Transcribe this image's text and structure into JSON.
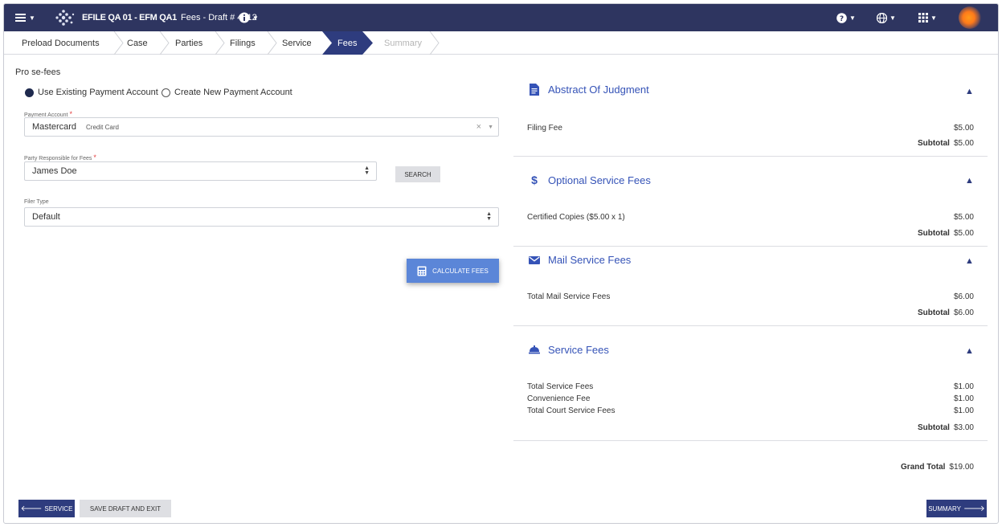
{
  "header": {
    "brand_title": "EFILE QA 01 - EFM QA1",
    "page_title": "Fees - Draft # 4312",
    "icons": [
      "hamburger-menu-icon",
      "logo-icon",
      "info-icon",
      "help-icon",
      "globe-icon",
      "apps-grid-icon",
      "avatar"
    ]
  },
  "steps": [
    {
      "label": "Preload Documents",
      "state": "done"
    },
    {
      "label": "Case",
      "state": "done"
    },
    {
      "label": "Parties",
      "state": "done"
    },
    {
      "label": "Filings",
      "state": "done"
    },
    {
      "label": "Service",
      "state": "done"
    },
    {
      "label": "Fees",
      "state": "active"
    },
    {
      "label": "Summary",
      "state": "disabled"
    }
  ],
  "form": {
    "section_title": "Pro se-fees",
    "radio_existing": "Use Existing Payment Account",
    "radio_new": "Create New Payment Account",
    "payment_account": {
      "label": "Payment Account",
      "value": "Mastercard",
      "sub": "Credit Card"
    },
    "party": {
      "label": "Party Responsible for Fees",
      "value": "James Doe"
    },
    "search_button": "SEARCH",
    "filer_type": {
      "label": "Filer Type",
      "value": "Default"
    },
    "calculate_button": "CALCULATE FEES",
    "required_mark": "*"
  },
  "fees": {
    "abstract": {
      "title": "Abstract Of Judgment",
      "lines": [
        {
          "label": "Filing Fee",
          "amount": "$5.00"
        }
      ],
      "subtotal_label": "Subtotal",
      "subtotal": "$5.00"
    },
    "optional": {
      "title": "Optional Service Fees",
      "lines": [
        {
          "label": "Certified Copies ($5.00 x 1)",
          "amount": "$5.00"
        }
      ],
      "subtotal_label": "Subtotal",
      "subtotal": "$5.00"
    },
    "mail": {
      "title": "Mail Service Fees",
      "lines": [
        {
          "label": "Total Mail Service Fees",
          "amount": "$6.00"
        }
      ],
      "subtotal_label": "Subtotal",
      "subtotal": "$6.00"
    },
    "service": {
      "title": "Service Fees",
      "lines": [
        {
          "label": "Total Service Fees",
          "amount": "$1.00"
        },
        {
          "label": "Convenience Fee",
          "amount": "$1.00"
        },
        {
          "label": "Total Court Service Fees",
          "amount": "$1.00"
        }
      ],
      "subtotal_label": "Subtotal",
      "subtotal": "$3.00"
    },
    "grand_total_label": "Grand Total",
    "grand_total": "$19.00"
  },
  "footer": {
    "back_button": "SERVICE",
    "save_button": "SAVE DRAFT AND EXIT",
    "next_button": "SUMMARY"
  },
  "colors": {
    "header_bg": "#2e3560",
    "active_step": "#2e3c7e",
    "accent_blue": "#3553b7",
    "calculate_button": "#5b86d8"
  }
}
